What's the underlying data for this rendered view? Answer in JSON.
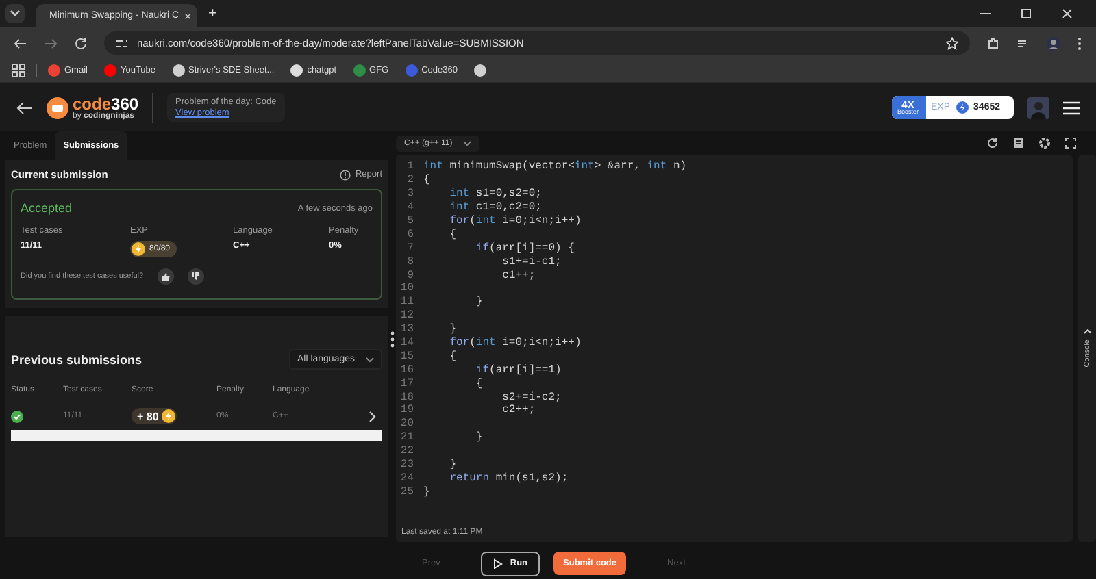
{
  "browser": {
    "tab": {
      "title": "Minimum Swapping - Naukri C",
      "close": "×"
    },
    "new_tab": "+",
    "url": "naukri.com/code360/problem-of-the-day/moderate?leftPanelTabValue=SUBMISSION",
    "bookmarks": [
      {
        "kind": "gmail",
        "label": "Gmail"
      },
      {
        "kind": "youtube",
        "label": "YouTube"
      },
      {
        "kind": "globe",
        "label": "Striver's SDE Sheet..."
      },
      {
        "kind": "chat",
        "label": "chatgpt"
      },
      {
        "kind": "gfg",
        "label": "GFG"
      },
      {
        "kind": "code360",
        "label": "Code360"
      },
      {
        "kind": "globe"
      }
    ]
  },
  "header": {
    "logo": {
      "name": "code",
      "number": "360",
      "by": "by",
      "brand": "codingninjas"
    },
    "potd": {
      "label": "Problem of the day: Code",
      "link": "View problem"
    },
    "booster": {
      "multiplier": "4X",
      "label": "Booster"
    },
    "exp": {
      "label": "EXP",
      "value": "34652"
    }
  },
  "left_panel": {
    "tabs": [
      {
        "label": "Problem",
        "selected": false
      },
      {
        "label": "Submissions",
        "selected": true
      }
    ],
    "current": {
      "title": "Current submission",
      "report": "Report",
      "status": "Accepted",
      "time": "A few seconds ago",
      "stats": [
        {
          "kind": "text",
          "label": "Test cases",
          "value": "11/11"
        },
        {
          "kind": "exp",
          "label": "EXP",
          "value": "80/80"
        },
        {
          "kind": "text",
          "label": "Language",
          "value": "C++"
        },
        {
          "kind": "text",
          "label": "Penalty",
          "value": "0%"
        }
      ],
      "feedback": "Did you find these test cases useful?"
    },
    "previous": {
      "title": "Previous submissions",
      "filter": "All languages",
      "columns": [
        "Status",
        "Test cases",
        "Score",
        "Penalty",
        "Language"
      ],
      "rows": [
        {
          "kind": "accepted",
          "test_cases": "11/11",
          "score": "+ 80",
          "penalty": "0%",
          "language": "C++"
        }
      ]
    }
  },
  "editor": {
    "language": "C++ (g++ 11)",
    "lines": [
      {
        "number": "1",
        "tokens": [
          {
            "kind": "kw",
            "text": "int"
          },
          {
            "kind": "plain",
            "text": " minimumSwap(vector<"
          },
          {
            "kind": "kw",
            "text": "int"
          },
          {
            "kind": "plain",
            "text": "> &arr, "
          },
          {
            "kind": "kw",
            "text": "int"
          },
          {
            "kind": "plain",
            "text": " n)"
          }
        ]
      },
      {
        "number": "2",
        "tokens": [
          {
            "kind": "plain",
            "text": "{"
          }
        ]
      },
      {
        "number": "3",
        "tokens": [
          {
            "kind": "kw",
            "text": "    int"
          },
          {
            "kind": "plain",
            "text": " s1=0,s2=0;"
          }
        ]
      },
      {
        "number": "4",
        "tokens": [
          {
            "kind": "kw",
            "text": "    int"
          },
          {
            "kind": "plain",
            "text": " c1=0,c2=0;"
          }
        ]
      },
      {
        "number": "5",
        "tokens": [
          {
            "kind": "ctrl",
            "text": "    for"
          },
          {
            "kind": "plain",
            "text": "("
          },
          {
            "kind": "kw",
            "text": "int"
          },
          {
            "kind": "plain",
            "text": " i=0;i<n;i++)"
          }
        ]
      },
      {
        "number": "6",
        "tokens": [
          {
            "kind": "plain",
            "text": "    {"
          }
        ]
      },
      {
        "number": "7",
        "tokens": [
          {
            "kind": "ctrl",
            "text": "        if"
          },
          {
            "kind": "plain",
            "text": "(arr[i]==0) {"
          }
        ]
      },
      {
        "number": "8",
        "tokens": [
          {
            "kind": "plain",
            "text": "            s1+=i-c1;"
          }
        ]
      },
      {
        "number": "9",
        "tokens": [
          {
            "kind": "plain",
            "text": "            c1++;"
          }
        ]
      },
      {
        "number": "10"
      },
      {
        "number": "11",
        "tokens": [
          {
            "kind": "plain",
            "text": "        }"
          }
        ]
      },
      {
        "number": "12"
      },
      {
        "number": "13",
        "tokens": [
          {
            "kind": "plain",
            "text": "    }"
          }
        ]
      },
      {
        "number": "14",
        "tokens": [
          {
            "kind": "ctrl",
            "text": "    for"
          },
          {
            "kind": "plain",
            "text": "("
          },
          {
            "kind": "kw",
            "text": "int"
          },
          {
            "kind": "plain",
            "text": " i=0;i<n;i++)"
          }
        ]
      },
      {
        "number": "15",
        "tokens": [
          {
            "kind": "plain",
            "text": "    {"
          }
        ]
      },
      {
        "number": "16",
        "tokens": [
          {
            "kind": "ctrl",
            "text": "        if"
          },
          {
            "kind": "plain",
            "text": "(arr[i]==1)"
          }
        ]
      },
      {
        "number": "17",
        "tokens": [
          {
            "kind": "plain",
            "text": "        {"
          }
        ]
      },
      {
        "number": "18",
        "tokens": [
          {
            "kind": "plain",
            "text": "            s2+=i-c2;"
          }
        ]
      },
      {
        "number": "19",
        "tokens": [
          {
            "kind": "plain",
            "text": "            c2++;"
          }
        ]
      },
      {
        "number": "20"
      },
      {
        "number": "21",
        "tokens": [
          {
            "kind": "plain",
            "text": "        }"
          }
        ]
      },
      {
        "number": "22"
      },
      {
        "number": "23",
        "tokens": [
          {
            "kind": "plain",
            "text": "    }"
          }
        ]
      },
      {
        "number": "24",
        "tokens": [
          {
            "kind": "ctrl",
            "text": "    return"
          },
          {
            "kind": "plain",
            "text": " min(s1,s2);"
          }
        ]
      },
      {
        "number": "25",
        "tokens": [
          {
            "kind": "plain",
            "text": "}"
          }
        ]
      }
    ],
    "saved": "Last saved at 1:11 PM",
    "console": "Console"
  },
  "footer": {
    "buttons": [
      {
        "kind": "prev",
        "label": "Prev",
        "disabled": true
      },
      {
        "kind": "run",
        "label": "Run"
      },
      {
        "kind": "submit",
        "label": "Submit code"
      },
      {
        "kind": "next",
        "label": "Next",
        "disabled": true
      }
    ]
  }
}
